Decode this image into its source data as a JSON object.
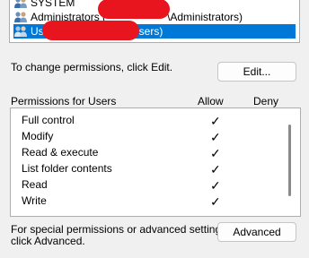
{
  "groups": {
    "items": [
      {
        "prefix": "SYSTEM",
        "suffix": ""
      },
      {
        "prefix": "Administrators (",
        "suffix": "\\Administrators)"
      },
      {
        "prefix": "Users (",
        "suffix": "\\Users)"
      }
    ],
    "selected_index": 2
  },
  "change_permissions": {
    "text": "To change permissions, click Edit.",
    "edit_button": "Edit..."
  },
  "permissions": {
    "header_label": "Permissions for Users",
    "allow_header": "Allow",
    "deny_header": "Deny",
    "check_glyph": "✓",
    "rows": [
      {
        "name": "Full control",
        "allow": true,
        "deny": false
      },
      {
        "name": "Modify",
        "allow": true,
        "deny": false
      },
      {
        "name": "Read & execute",
        "allow": true,
        "deny": false
      },
      {
        "name": "List folder contents",
        "allow": true,
        "deny": false
      },
      {
        "name": "Read",
        "allow": true,
        "deny": false
      },
      {
        "name": "Write",
        "allow": true,
        "deny": false
      }
    ]
  },
  "advanced": {
    "line1": "For special permissions or advanced settings,",
    "line2": "click Advanced.",
    "button": "Advanced"
  },
  "colors": {
    "selection": "#0078d7",
    "redaction": "#e8141e"
  }
}
